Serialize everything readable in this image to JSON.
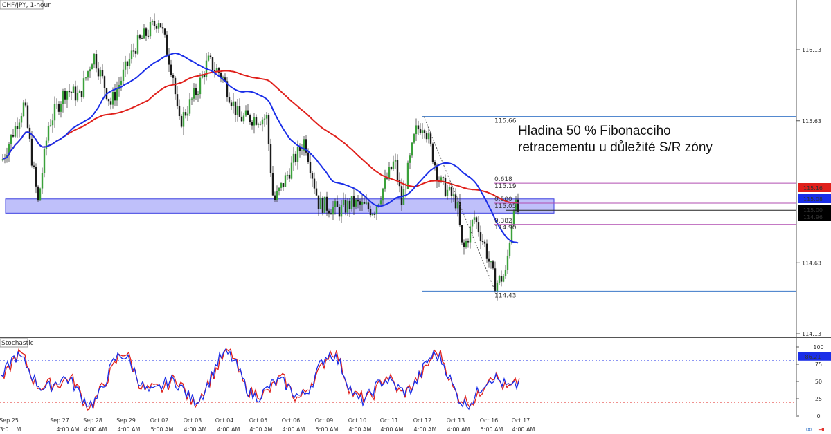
{
  "chart_data": [
    {
      "type": "candlestick",
      "title": "CHF/JPY, 1-hour",
      "price_axis_ticks": [
        "116.13",
        "115.63",
        "114.63",
        "114.13"
      ],
      "ylim": [
        114.13,
        116.4
      ],
      "current_price_labels": [
        {
          "value": "115.16",
          "color": "#e0201b"
        },
        {
          "value": "115.08",
          "color": "#1a2ee8"
        },
        {
          "value": "115.00",
          "color": "#000000"
        },
        {
          "value": "114.96",
          "color": "#000000"
        }
      ],
      "x_date_labels": [
        "Sep 25",
        "Sep 27",
        "Sep 28",
        "Sep 29",
        "Oct 02",
        "Oct 03",
        "Oct 04",
        "Oct 05",
        "Oct 06",
        "Oct 09",
        "Oct 10",
        "Oct 11",
        "Oct 12",
        "Oct 13",
        "Oct 16",
        "Oct 17"
      ],
      "x_time_labels": [
        "3:0",
        "M",
        "4:00 AM",
        "4:00 AM",
        "4:00 AM",
        "5:00 AM",
        "4:00 AM",
        "4:00 AM",
        "4:00 AM",
        "4:00 AM",
        "5:00 AM",
        "4:00 AM",
        "4:00 AM",
        "4:00 AM",
        "4:00 AM",
        "5:00 AM",
        "4:00 AM"
      ],
      "series": [
        {
          "name": "",
          "kind": "moving-average",
          "color": "#1a2ee8"
        },
        {
          "name": "",
          "kind": "moving-average",
          "color": "#e0201b"
        }
      ],
      "sr_zone": {
        "low": 114.98,
        "high": 115.08,
        "color": "#8a8cf5"
      },
      "fibonacci": {
        "swing_high": "115.66",
        "swing_low": "114.43",
        "levels": [
          {
            "ratio": "0.618",
            "price": "115.19"
          },
          {
            "ratio": "0.500",
            "price": "115.05"
          },
          {
            "ratio": "0.382",
            "price": "114.90"
          }
        ],
        "color": "#b04db0"
      },
      "annotation_lines": [
        "Hladina 50 % Fibonacciho",
        "retracementu u důležité S/R zóny"
      ]
    },
    {
      "type": "line",
      "title": "Stochastic",
      "yticks": [
        "100",
        "75",
        "50",
        "25",
        "0"
      ],
      "ylim": [
        0,
        100
      ],
      "levels": {
        "overbought": 80,
        "oversold": 20
      },
      "current_value": "86.21",
      "series": [
        {
          "name": "",
          "color": "#1a2ee8"
        },
        {
          "name": "",
          "color": "#e0201b"
        }
      ]
    }
  ],
  "toolbar_icons": [
    "infinity-icon",
    "arrow-right-icon"
  ]
}
